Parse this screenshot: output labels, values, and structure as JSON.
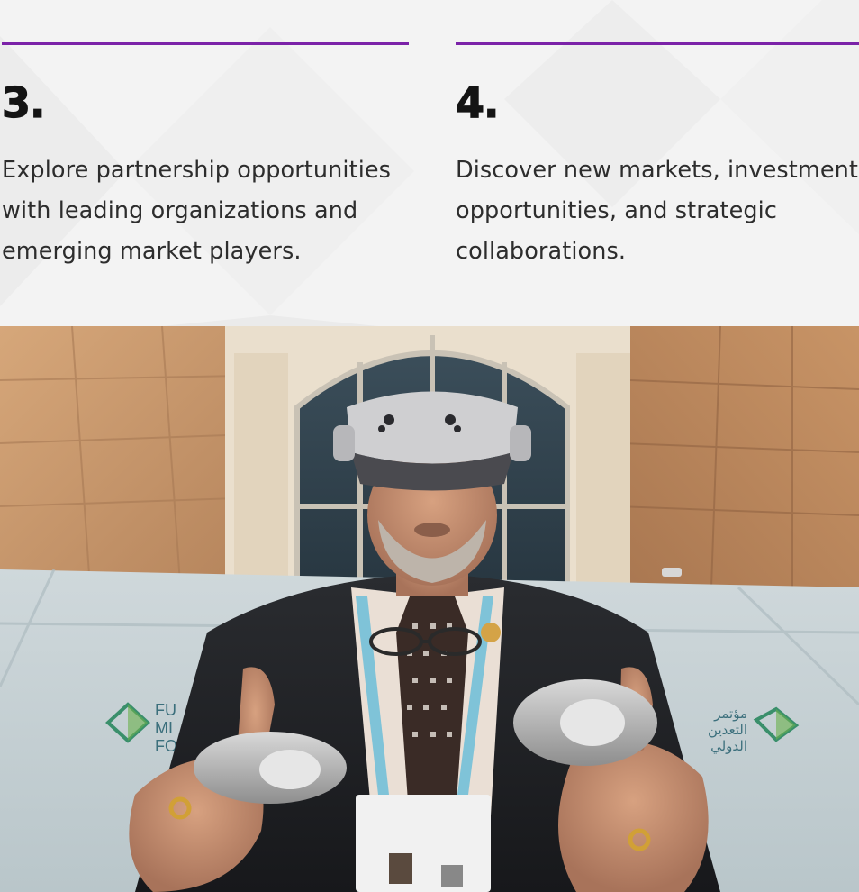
{
  "items": [
    {
      "number": "3.",
      "text": "Explore partnership opportunities with leading organizations and emerging market players."
    },
    {
      "number": "4.",
      "text": "Discover new markets, investment opportunities, and strategic collaborations."
    }
  ],
  "photo": {
    "sign_left_text": "FU\nMI\nFO",
    "sign_right_text": "مؤتمر\nالتعدين\nالدولي"
  },
  "colors": {
    "accent": "#7b22a8",
    "number": "#141414",
    "text": "#2d2d2d",
    "background": "#f4f4f4"
  }
}
